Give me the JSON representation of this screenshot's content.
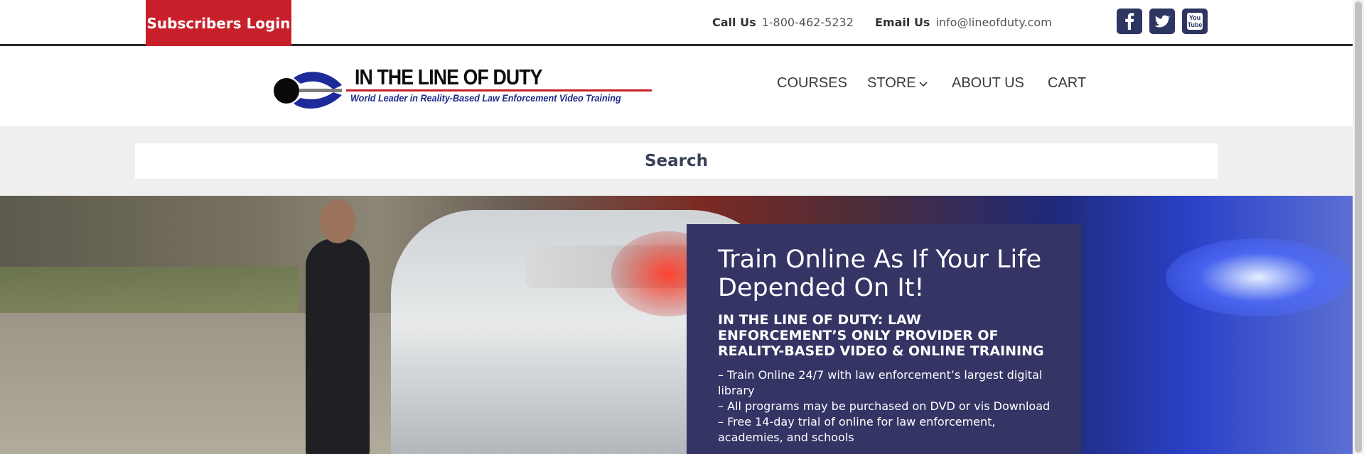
{
  "topbar": {
    "login_label": "Subscribers Login",
    "call_label": "Call Us",
    "call_value": "1-800-462-5232",
    "email_label": "Email Us",
    "email_value": "info@lineofduty.com",
    "social": [
      "facebook-icon",
      "twitter-icon",
      "youtube-icon"
    ]
  },
  "logo": {
    "title": "IN THE LINE OF DUTY",
    "tagline": "World Leader in Reality-Based Law Enforcement Video Training"
  },
  "nav": {
    "courses": "COURSES",
    "store": "STORE",
    "about": "ABOUT US",
    "cart": "CART"
  },
  "search": {
    "label": "Search"
  },
  "hero": {
    "headline": "Train Online As If Your Life Depended On It!",
    "subheadline": "IN THE LINE OF DUTY: LAW ENFORCEMENT’S ONLY PROVIDER OF REALITY-BASED VIDEO & ONLINE TRAINING",
    "bullets": [
      "– Train Online 24/7 with law enforcement’s largest digital library",
      "– All programs may be purchased on DVD or vis Download",
      "– Free 14-day trial of online for law enforcement, academies, and schools"
    ]
  },
  "colors": {
    "login_red": "#c8202a",
    "card_navy": "#343465",
    "social_navy": "#2e3560"
  }
}
